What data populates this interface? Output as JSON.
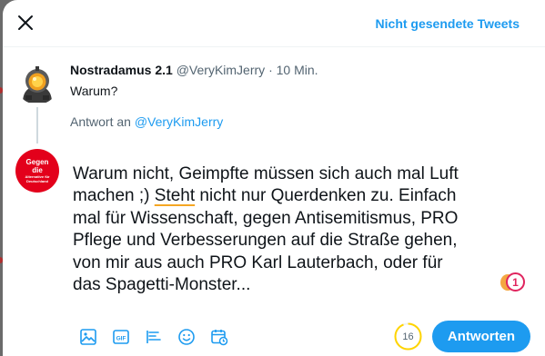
{
  "header": {
    "close_icon": "close-icon",
    "unsent_tweets_label": "Nicht gesendete Tweets"
  },
  "original_tweet": {
    "author_name": "Nostradamus 2.1",
    "author_handle": "@VeryKimJerry",
    "separator": "·",
    "time": "10 Min.",
    "text": "Warum?"
  },
  "reply_to": {
    "prefix": "Antwort an",
    "handle": "@VeryKimJerry"
  },
  "reply_avatar": {
    "line1": "Gegen",
    "line2": "die",
    "line3": "Alternative für Deutschland"
  },
  "compose": {
    "text_before": "Warum nicht, Geimpfte müssen sich auch mal Luft machen ;) ",
    "flagged_word": "Steht",
    "text_after": " nicht nur Querdenken zu. Einfach mal für Wissenschaft, gegen Antisemitismus, PRO Pflege und Verbesserungen auf die Straße gehen, von mir aus auch PRO Karl Lauterbach, oder für das Spagetti-Monster..."
  },
  "grammar_badge": {
    "count": "1"
  },
  "toolbar": {
    "icons": [
      "image-icon",
      "gif-icon",
      "poll-icon",
      "emoji-icon",
      "schedule-icon"
    ]
  },
  "char_counter": {
    "remaining": "16",
    "fraction_used": 0.94
  },
  "reply_button_label": "Antworten",
  "colors": {
    "accent": "#1d9bf0",
    "counter_warning": "#ffd400",
    "flag_underline": "#f5a623",
    "grammar_error": "#e0245e"
  }
}
